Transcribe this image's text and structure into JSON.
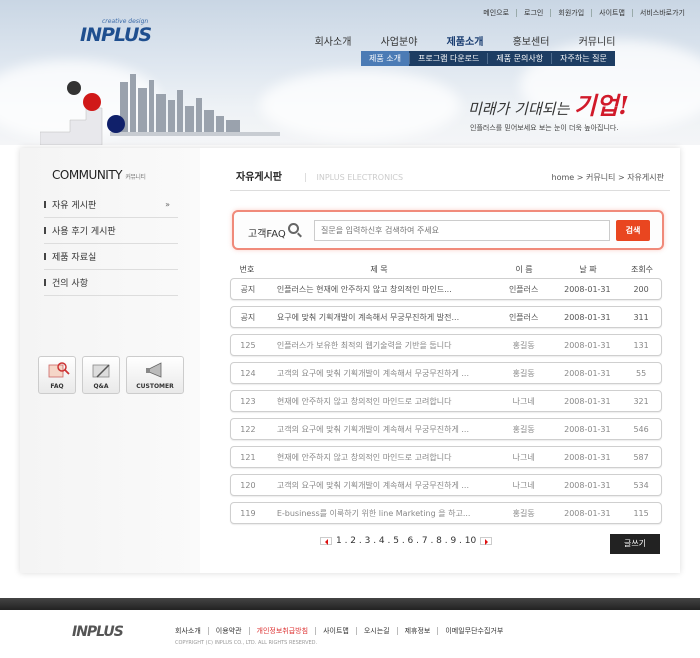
{
  "header": {
    "util_links": [
      "메인으로",
      "로그인",
      "회원가입",
      "사이트맵",
      "서비스바로가기"
    ],
    "logo_text": "INPLUS",
    "logo_tag": "creative design",
    "gnb": [
      "회사소개",
      "사업분야",
      "제품소개",
      "홍보센터",
      "커뮤니티"
    ],
    "sub_menu": [
      "제품 소개",
      "프로그램 다운로드",
      "제품 문의사항",
      "자주하는 질문"
    ],
    "slogan_prefix": "미래가 기대되는",
    "slogan_bold": "기업!",
    "slogan_sub": "인플러스를 믿어보세요 보는 눈이 더욱 높아집니다."
  },
  "sidebar": {
    "title": "COMMUNITY",
    "title_sub": "커뮤니티",
    "items": [
      {
        "label": "자유 게시판",
        "arrow": "»"
      },
      {
        "label": "사용 후기 게시판"
      },
      {
        "label": "제품 자료실"
      },
      {
        "label": "건의 사항"
      }
    ],
    "quick": [
      {
        "label": "FAQ"
      },
      {
        "label": "Q&A"
      },
      {
        "label": "CUSTOMER"
      }
    ]
  },
  "main": {
    "title": "자유게시판",
    "title_en": "INPLUS ELECTRONICS",
    "breadcrumb": "home  >  커뮤니티  >  자유게시판",
    "search": {
      "label": "고객FAQ",
      "placeholder": "질문을 입력하신후 검색하여 주세요",
      "button": "검색"
    },
    "columns": [
      "번호",
      "제 목",
      "이 름",
      "날 짜",
      "조회수"
    ],
    "rows": [
      {
        "no": "공지",
        "title": "인플러스는 현재에 안주하지 않고 창의적인 마인드...",
        "name": "인플러스",
        "date": "2008-01-31",
        "hits": "200",
        "notice": true
      },
      {
        "no": "공지",
        "title": "요구에 맞춰 기획개발이 계속해서 무궁무진하게 발전...",
        "name": "인플러스",
        "date": "2008-01-31",
        "hits": "311",
        "notice": true
      },
      {
        "no": "125",
        "title": "인플러스가 보유한 최적의 웹기술력을 기반을 둡니다",
        "name": "홍길동",
        "date": "2008-01-31",
        "hits": "131"
      },
      {
        "no": "124",
        "title": "고객의 요구에 맞춰 기획개발이 계속해서 무궁무진하게 ...",
        "name": "홍길동",
        "date": "2008-01-31",
        "hits": "55"
      },
      {
        "no": "123",
        "title": "현재에 안주하지 않고 창의적인 마인드로 고려합니다",
        "name": "나그네",
        "date": "2008-01-31",
        "hits": "321"
      },
      {
        "no": "122",
        "title": "고객의 요구에 맞춰 기획개발이 계속해서 무궁무진하게 ...",
        "name": "홍길동",
        "date": "2008-01-31",
        "hits": "546"
      },
      {
        "no": "121",
        "title": "현재에 안주하지 않고 창의적인 마인드로 고려합니다",
        "name": "나그네",
        "date": "2008-01-31",
        "hits": "587"
      },
      {
        "no": "120",
        "title": "고객의 요구에 맞춰 기획개발이 계속해서 무궁무진하게 ...",
        "name": "나그네",
        "date": "2008-01-31",
        "hits": "534"
      },
      {
        "no": "119",
        "title": "E-business를 이룩하기 위한 line Marketing 을 하고...",
        "name": "홍길동",
        "date": "2008-01-31",
        "hits": "115"
      }
    ],
    "pages": "1 . 2 . 3 . 4 . 5 . 6 . 7 . 8 . 9 . 10",
    "write_button": "글쓰기"
  },
  "footer": {
    "logo_text": "INPLUS",
    "links": [
      "회사소개",
      "이용약관",
      "개인정보취급방침",
      "사이트맵",
      "오시는길",
      "제휴정보",
      "이메일무단수집거부"
    ],
    "copyright": "COPYRIGHT (C) INPLUS CO., LTD. ALL RIGHTS RESERVED."
  },
  "colors": {
    "accent_red": "#e94620",
    "navy": "#1d3d63",
    "brand_blue": "#1f4f8f"
  }
}
